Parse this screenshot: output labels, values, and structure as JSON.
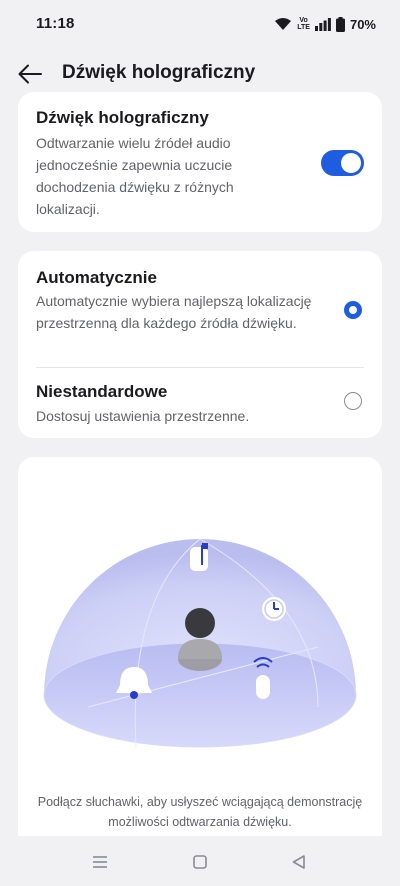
{
  "status": {
    "time": "11:18",
    "volte_top": "Vo",
    "volte_bottom": "LTE",
    "battery": "70%"
  },
  "header": {
    "title": "Dźwięk holograficzny"
  },
  "holographic": {
    "title": "Dźwięk holograficzny",
    "description": "Odtwarzanie wielu źródeł audio jednocześnie zapewnia uczucie dochodzenia dźwięku z różnych lokalizacji.",
    "enabled": true
  },
  "mode": {
    "options": [
      {
        "title": "Automatycznie",
        "description": "Automatycznie wybiera najlepszą lokalizację przestrzenną dla każdego źródła dźwięku.",
        "selected": true
      },
      {
        "title": "Niestandardowe",
        "description": "Dostosuj ustawienia przestrzenne.",
        "selected": false
      }
    ]
  },
  "illustration": {
    "caption": "Podłącz słuchawki, aby usłyszeć wciągającą demonstrację możliwości odtwarzania dźwięku."
  },
  "colors": {
    "accent": "#1f5de0",
    "background": "#f1f1f4",
    "card": "#ffffff"
  }
}
